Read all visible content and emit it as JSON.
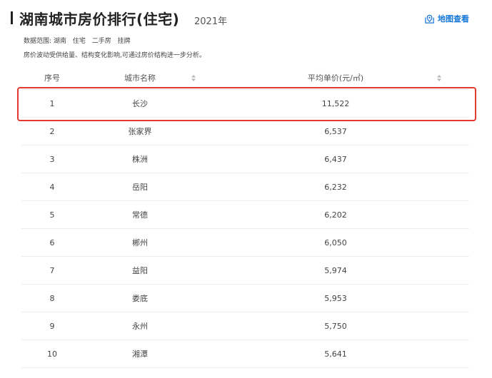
{
  "header": {
    "title": "湖南城市房价排行(住宅)",
    "year": "2021年",
    "map_link_label": "地图查看"
  },
  "meta": {
    "scope_label": "数据范围:",
    "scope_items": [
      "湖南",
      "住宅",
      "二手房",
      "挂牌"
    ],
    "note": "房价波动受供给量、结构变化影响,可通过房价结构进一步分析。"
  },
  "table": {
    "columns": {
      "rank": "序号",
      "city": "城市名称",
      "price": "平均单价(元/㎡)"
    },
    "rows": [
      {
        "rank": "1",
        "city": "长沙",
        "price": "11,522"
      },
      {
        "rank": "2",
        "city": "张家界",
        "price": "6,537"
      },
      {
        "rank": "3",
        "city": "株洲",
        "price": "6,437"
      },
      {
        "rank": "4",
        "city": "岳阳",
        "price": "6,232"
      },
      {
        "rank": "5",
        "city": "常德",
        "price": "6,202"
      },
      {
        "rank": "6",
        "city": "郴州",
        "price": "6,050"
      },
      {
        "rank": "7",
        "city": "益阳",
        "price": "5,974"
      },
      {
        "rank": "8",
        "city": "娄底",
        "price": "5,953"
      },
      {
        "rank": "9",
        "city": "永州",
        "price": "5,750"
      },
      {
        "rank": "10",
        "city": "湘潭",
        "price": "5,641"
      }
    ]
  },
  "colors": {
    "accent": "#1677d9",
    "highlight": "#e23a2f"
  }
}
